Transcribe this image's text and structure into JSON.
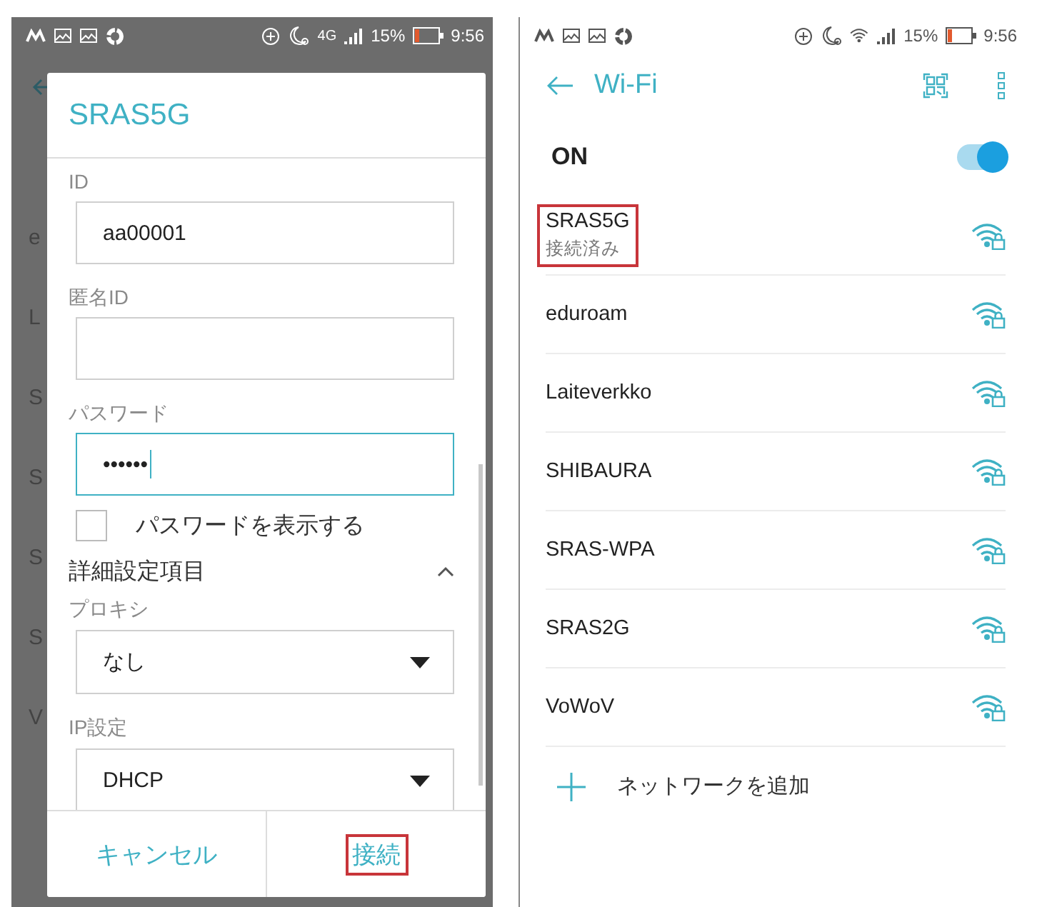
{
  "left_screen": {
    "status_bar": {
      "network": "4G",
      "battery": "15%",
      "time": "9:56"
    },
    "background_rows": [
      {
        "letter": "e"
      },
      {
        "letter": "L"
      },
      {
        "letter": "S"
      },
      {
        "letter": "S"
      },
      {
        "letter": "S"
      },
      {
        "letter": "S"
      },
      {
        "letter": "V"
      }
    ],
    "dialog": {
      "title": "SRAS5G",
      "fields": [
        {
          "label": "ID",
          "value": "aa00001",
          "focused": false
        },
        {
          "label": "匿名ID",
          "focused": false
        },
        {
          "label": "パスワード",
          "value": "••••••",
          "focused": true
        }
      ],
      "show_password": {
        "label": "パスワードを表示する",
        "checked": false
      },
      "advanced": {
        "title": "詳細設定項目",
        "expanded": true
      },
      "dropdowns": [
        {
          "label": "プロキシ",
          "value": "なし"
        },
        {
          "label": "IP設定",
          "value": "DHCP"
        }
      ],
      "buttons": [
        {
          "label": "キャンセル",
          "highlighted": false
        },
        {
          "label": "接続",
          "highlighted": true
        }
      ]
    }
  },
  "right_screen": {
    "status_bar": {
      "battery": "15%",
      "time": "9:56"
    },
    "header": {
      "title": "Wi-Fi"
    },
    "wifi_switch": {
      "label": "ON",
      "on": true
    },
    "networks": [
      {
        "ssid": "SRAS5G",
        "status": "接続済み",
        "highlighted": true
      },
      {
        "ssid": "eduroam",
        "highlighted": false
      },
      {
        "ssid": "Laiteverkko",
        "highlighted": false
      },
      {
        "ssid": "SHIBAURA",
        "highlighted": false
      },
      {
        "ssid": "SRAS-WPA",
        "highlighted": false
      },
      {
        "ssid": "SRAS2G",
        "highlighted": false
      },
      {
        "ssid": "VoWoV",
        "highlighted": false
      }
    ],
    "add_network": {
      "label": "ネットワークを追加"
    }
  }
}
